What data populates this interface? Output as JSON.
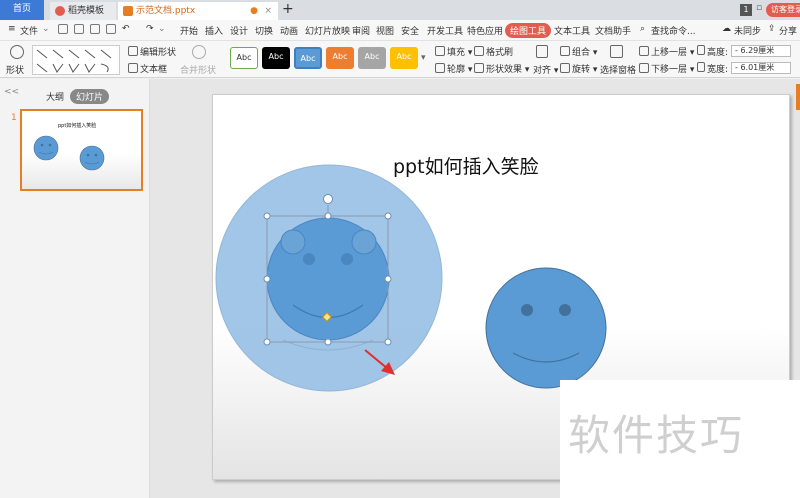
{
  "tabbar": {
    "home": "首页",
    "template": "稻壳模板",
    "document": "示范文档.pptx",
    "close": "×",
    "add": "+",
    "page_indicator": "1",
    "visitor": "访客登录"
  },
  "menu": {
    "file": "文件",
    "items": [
      "开始",
      "插入",
      "设计",
      "切换",
      "动画",
      "幻灯片放映",
      "审阅",
      "视图",
      "安全",
      "开发工具",
      "特色应用",
      "绘图工具",
      "文本工具",
      "文档助手"
    ],
    "active": "绘图工具",
    "search": "查找命令...",
    "sync": "未同步",
    "share": "分享"
  },
  "ribbon": {
    "shape": "形状",
    "edit_shape": "编辑形状",
    "textbox": "文本框",
    "merge_shape": "合并形状",
    "style_label": "Abc",
    "fill": "填充",
    "format_brush": "格式刷",
    "outline": "轮廓",
    "shape_effect": "形状效果",
    "align": "对齐",
    "group": "组合",
    "rotate": "旋转",
    "selection_pane": "选择窗格",
    "bring_forward": "上移一层",
    "send_backward": "下移一层",
    "height_label": "高度:",
    "height_value": "6.29厘米",
    "width_label": "宽度:",
    "width_value": "6.01厘米"
  },
  "style_colors": [
    "#ffffff",
    "#000000",
    "#5b9bd5",
    "#ed7d31",
    "#a5a5a5",
    "#ffc000"
  ],
  "left_pane": {
    "collapse": "<<",
    "outline_tab": "大纲",
    "slides_tab": "幻灯片",
    "slide_number": "1",
    "thumb_title": "ppt如何插入笑脸"
  },
  "slide": {
    "title": "ppt如何插入笑脸"
  },
  "colors": {
    "accent": "#e25d4f",
    "smiley": "#5b9bd5",
    "smiley_border": "#41719c",
    "large_circle": "#9dc3e6",
    "arrow": "#e0302d"
  },
  "watermark": "软件技巧"
}
